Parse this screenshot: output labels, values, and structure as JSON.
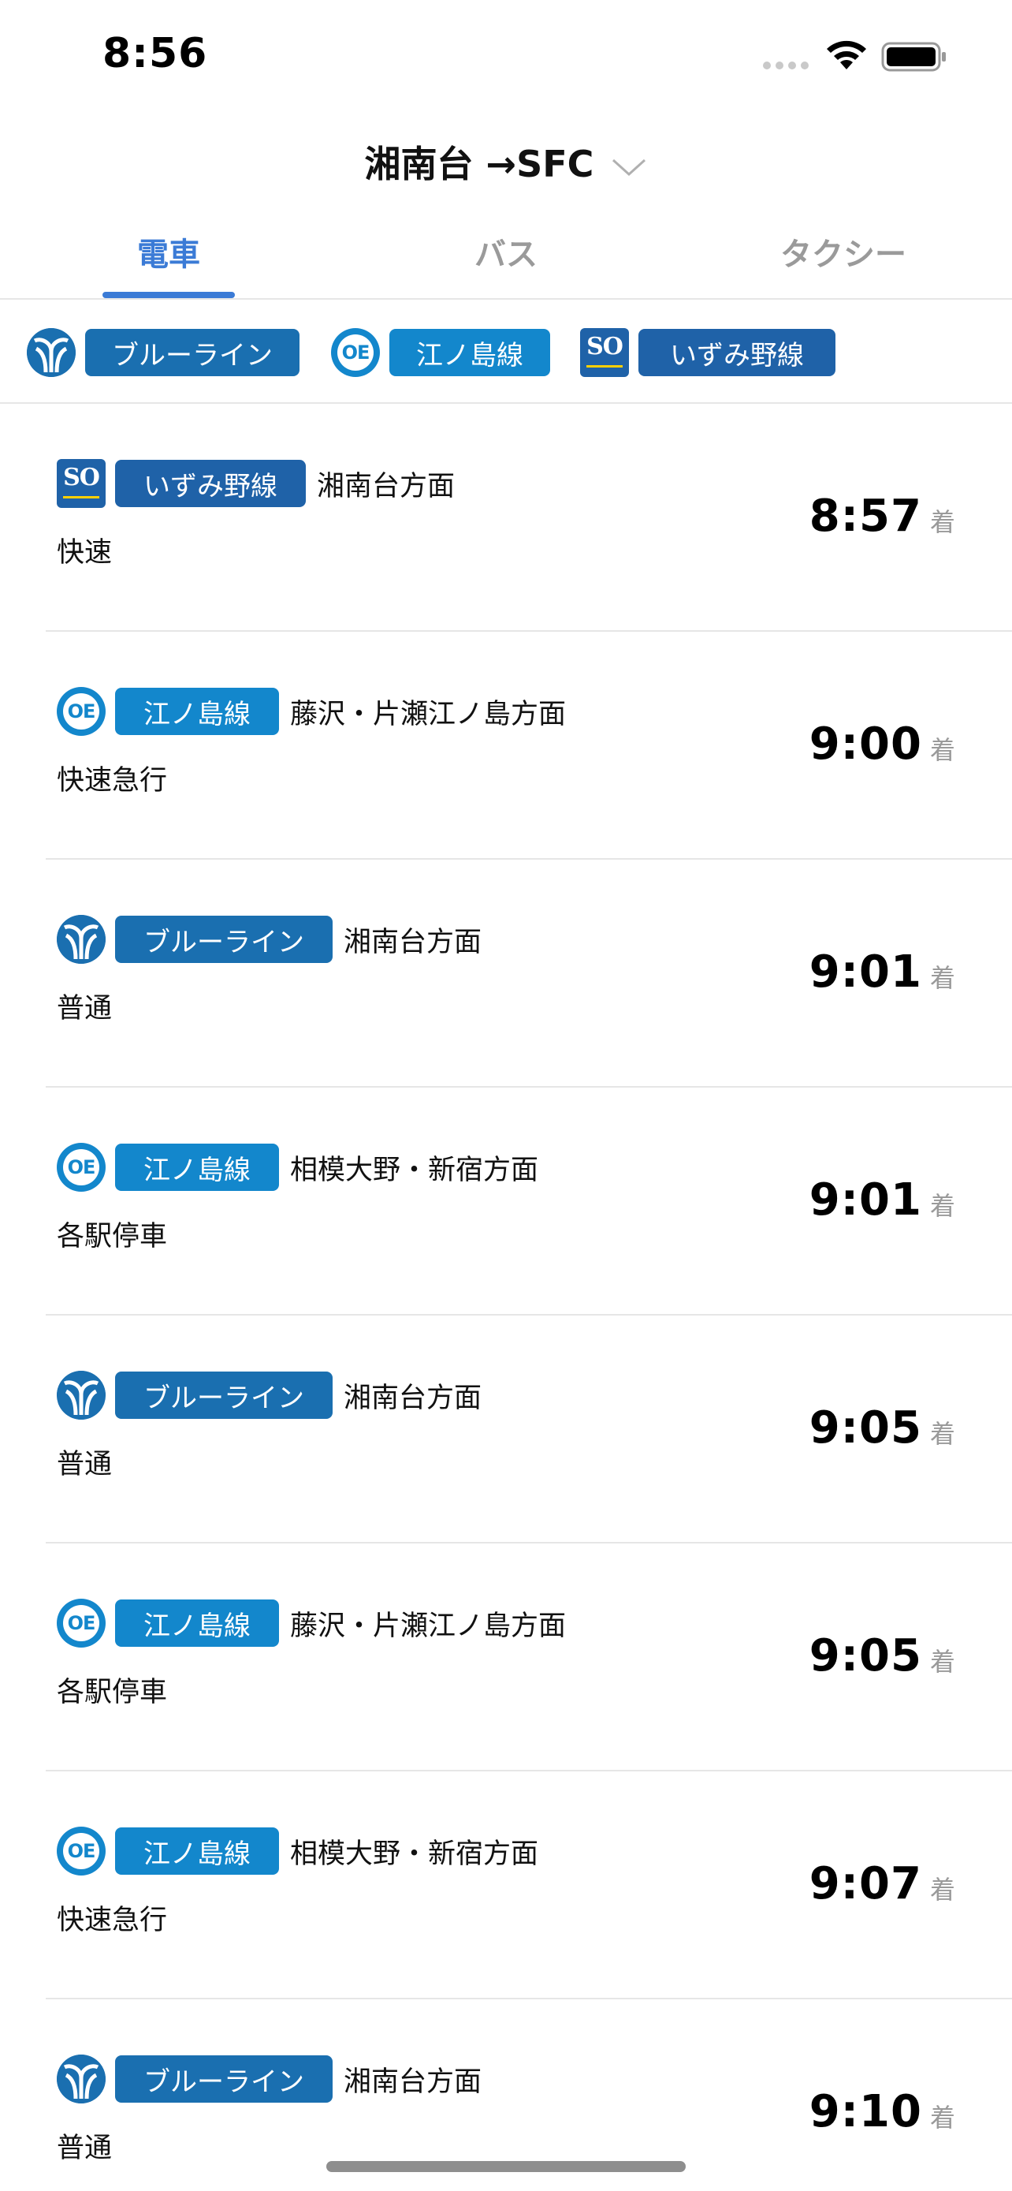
{
  "status_bar": {
    "time": "8:56"
  },
  "header": {
    "title": "湘南台 →SFC"
  },
  "tabs": [
    {
      "label": "電車",
      "active": true
    },
    {
      "label": "バス",
      "active": false
    },
    {
      "label": "タクシー",
      "active": false
    }
  ],
  "filters": [
    {
      "logo": "blueline-logo-icon",
      "label": "ブルーライン",
      "color": "#1a6fb0"
    },
    {
      "logo": "odakyu-enoshima-logo-icon",
      "logo_text": "OE",
      "label": "江ノ島線",
      "color": "#1387cc"
    },
    {
      "logo": "sotetsu-logo-icon",
      "logo_text": "SO",
      "label": "いずみ野線",
      "color": "#1f62a8"
    }
  ],
  "trains": [
    {
      "logo": "sotetsu-logo-icon",
      "logo_text": "SO",
      "line": "いずみ野線",
      "color": "#1f62a8",
      "direction": "湘南台方面",
      "service": "快速",
      "time": "8:57",
      "suffix": "着"
    },
    {
      "logo": "odakyu-enoshima-logo-icon",
      "logo_text": "OE",
      "line": "江ノ島線",
      "color": "#1387cc",
      "direction": "藤沢・片瀬江ノ島方面",
      "service": "快速急行",
      "time": "9:00",
      "suffix": "着"
    },
    {
      "logo": "blueline-logo-icon",
      "line": "ブルーライン",
      "color": "#1a6fb0",
      "direction": "湘南台方面",
      "service": "普通",
      "time": "9:01",
      "suffix": "着"
    },
    {
      "logo": "odakyu-enoshima-logo-icon",
      "logo_text": "OE",
      "line": "江ノ島線",
      "color": "#1387cc",
      "direction": "相模大野・新宿方面",
      "service": "各駅停車",
      "time": "9:01",
      "suffix": "着"
    },
    {
      "logo": "blueline-logo-icon",
      "line": "ブルーライン",
      "color": "#1a6fb0",
      "direction": "湘南台方面",
      "service": "普通",
      "time": "9:05",
      "suffix": "着"
    },
    {
      "logo": "odakyu-enoshima-logo-icon",
      "logo_text": "OE",
      "line": "江ノ島線",
      "color": "#1387cc",
      "direction": "藤沢・片瀬江ノ島方面",
      "service": "各駅停車",
      "time": "9:05",
      "suffix": "着"
    },
    {
      "logo": "odakyu-enoshima-logo-icon",
      "logo_text": "OE",
      "line": "江ノ島線",
      "color": "#1387cc",
      "direction": "相模大野・新宿方面",
      "service": "快速急行",
      "time": "9:07",
      "suffix": "着"
    },
    {
      "logo": "blueline-logo-icon",
      "line": "ブルーライン",
      "color": "#1a6fb0",
      "direction": "湘南台方面",
      "service": "普通",
      "time": "9:10",
      "suffix": "着"
    }
  ]
}
